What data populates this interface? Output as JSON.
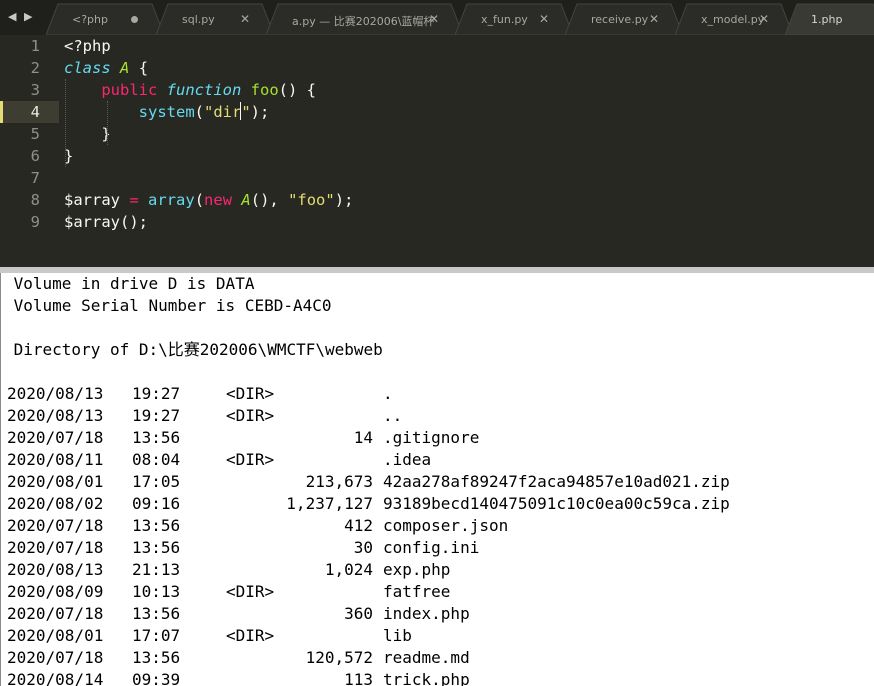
{
  "tabs": [
    {
      "label": "<?php",
      "state": "modified",
      "active": false
    },
    {
      "label": "sql.py",
      "state": "close",
      "active": false
    },
    {
      "label": "a.py — 比赛202006\\蓝帽杯",
      "state": "close",
      "active": false
    },
    {
      "label": "x_fun.py",
      "state": "close",
      "active": false
    },
    {
      "label": "receive.py",
      "state": "close",
      "active": false
    },
    {
      "label": "x_model.py",
      "state": "close",
      "active": false
    },
    {
      "label": "1.php",
      "state": "none",
      "active": true
    }
  ],
  "icons": {
    "nav": "left-right-arrows-icon",
    "close": "close-icon",
    "modified": "modified-dot-icon"
  },
  "colors": {
    "editor_bg": "#272822",
    "keyword": "#f92672",
    "function": "#a6e22e",
    "builtin": "#66d9ef",
    "string": "#e6db74"
  },
  "editor": {
    "current_line": 4,
    "lines": [
      {
        "n": "1",
        "tokens": [
          {
            "t": "<?php",
            "c": "var"
          }
        ]
      },
      {
        "n": "2",
        "tokens": [
          {
            "t": "class",
            "c": "st"
          },
          {
            "t": " ",
            "c": "var"
          },
          {
            "t": "A",
            "c": "cls"
          },
          {
            "t": " {",
            "c": "var"
          }
        ]
      },
      {
        "n": "3",
        "tokens": [
          {
            "t": "    ",
            "c": "var"
          },
          {
            "t": "public",
            "c": "kw"
          },
          {
            "t": " ",
            "c": "var"
          },
          {
            "t": "function",
            "c": "st"
          },
          {
            "t": " ",
            "c": "var"
          },
          {
            "t": "foo",
            "c": "fn"
          },
          {
            "t": "() {",
            "c": "var"
          }
        ]
      },
      {
        "n": "4",
        "tokens": [
          {
            "t": "        ",
            "c": "var"
          },
          {
            "t": "system",
            "c": "bi"
          },
          {
            "t": "(",
            "c": "var"
          },
          {
            "t": "\"dir\"",
            "c": "str"
          },
          {
            "t": ");",
            "c": "var"
          }
        ]
      },
      {
        "n": "5",
        "tokens": [
          {
            "t": "    }",
            "c": "var"
          }
        ]
      },
      {
        "n": "6",
        "tokens": [
          {
            "t": "}",
            "c": "var"
          }
        ]
      },
      {
        "n": "7",
        "tokens": []
      },
      {
        "n": "8",
        "tokens": [
          {
            "t": "$array",
            "c": "var"
          },
          {
            "t": " ",
            "c": "var"
          },
          {
            "t": "=",
            "c": "kw"
          },
          {
            "t": " ",
            "c": "var"
          },
          {
            "t": "array",
            "c": "bi"
          },
          {
            "t": "(",
            "c": "var"
          },
          {
            "t": "new",
            "c": "kw"
          },
          {
            "t": " ",
            "c": "var"
          },
          {
            "t": "A",
            "c": "cls"
          },
          {
            "t": "(), ",
            "c": "var"
          },
          {
            "t": "\"foo\"",
            "c": "str"
          },
          {
            "t": ");",
            "c": "var"
          }
        ]
      },
      {
        "n": "9",
        "tokens": [
          {
            "t": "$array();",
            "c": "var"
          }
        ]
      }
    ]
  },
  "console": {
    "header": [
      " Volume in drive D is DATA",
      " Volume Serial Number is CEBD-A4C0",
      "",
      " Directory of D:\\比赛202006\\WMCTF\\webweb",
      ""
    ],
    "entries": [
      {
        "date": "2020/08/13",
        "time": "19:27",
        "dir": "<DIR>",
        "size": "",
        "name": "."
      },
      {
        "date": "2020/08/13",
        "time": "19:27",
        "dir": "<DIR>",
        "size": "",
        "name": ".."
      },
      {
        "date": "2020/07/18",
        "time": "13:56",
        "dir": "",
        "size": "14",
        "name": ".gitignore"
      },
      {
        "date": "2020/08/11",
        "time": "08:04",
        "dir": "<DIR>",
        "size": "",
        "name": ".idea"
      },
      {
        "date": "2020/08/01",
        "time": "17:05",
        "dir": "",
        "size": "213,673",
        "name": "42aa278af89247f2aca94857e10ad021.zip"
      },
      {
        "date": "2020/08/02",
        "time": "09:16",
        "dir": "",
        "size": "1,237,127",
        "name": "93189becd140475091c10c0ea00c59ca.zip"
      },
      {
        "date": "2020/07/18",
        "time": "13:56",
        "dir": "",
        "size": "412",
        "name": "composer.json"
      },
      {
        "date": "2020/07/18",
        "time": "13:56",
        "dir": "",
        "size": "30",
        "name": "config.ini"
      },
      {
        "date": "2020/08/13",
        "time": "21:13",
        "dir": "",
        "size": "1,024",
        "name": "exp.php"
      },
      {
        "date": "2020/08/09",
        "time": "10:13",
        "dir": "<DIR>",
        "size": "",
        "name": "fatfree"
      },
      {
        "date": "2020/07/18",
        "time": "13:56",
        "dir": "",
        "size": "360",
        "name": "index.php"
      },
      {
        "date": "2020/08/01",
        "time": "17:07",
        "dir": "<DIR>",
        "size": "",
        "name": "lib"
      },
      {
        "date": "2020/07/18",
        "time": "13:56",
        "dir": "",
        "size": "120,572",
        "name": "readme.md"
      },
      {
        "date": "2020/08/14",
        "time": "09:39",
        "dir": "",
        "size": "113",
        "name": "trick.php"
      }
    ]
  }
}
